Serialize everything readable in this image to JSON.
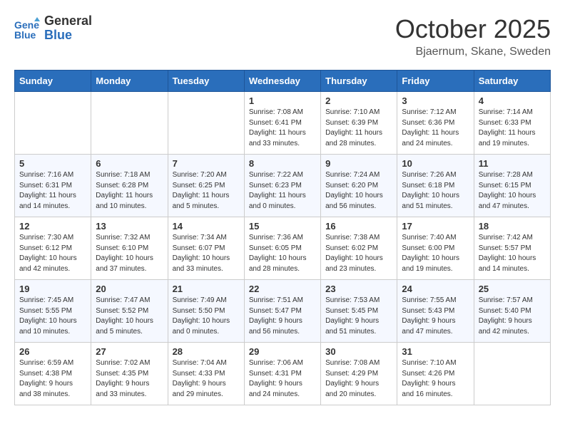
{
  "header": {
    "logo_line1": "General",
    "logo_line2": "Blue",
    "month": "October 2025",
    "location": "Bjaernum, Skane, Sweden"
  },
  "weekdays": [
    "Sunday",
    "Monday",
    "Tuesday",
    "Wednesday",
    "Thursday",
    "Friday",
    "Saturday"
  ],
  "weeks": [
    [
      {
        "day": "",
        "info": ""
      },
      {
        "day": "",
        "info": ""
      },
      {
        "day": "",
        "info": ""
      },
      {
        "day": "1",
        "info": "Sunrise: 7:08 AM\nSunset: 6:41 PM\nDaylight: 11 hours\nand 33 minutes."
      },
      {
        "day": "2",
        "info": "Sunrise: 7:10 AM\nSunset: 6:39 PM\nDaylight: 11 hours\nand 28 minutes."
      },
      {
        "day": "3",
        "info": "Sunrise: 7:12 AM\nSunset: 6:36 PM\nDaylight: 11 hours\nand 24 minutes."
      },
      {
        "day": "4",
        "info": "Sunrise: 7:14 AM\nSunset: 6:33 PM\nDaylight: 11 hours\nand 19 minutes."
      }
    ],
    [
      {
        "day": "5",
        "info": "Sunrise: 7:16 AM\nSunset: 6:31 PM\nDaylight: 11 hours\nand 14 minutes."
      },
      {
        "day": "6",
        "info": "Sunrise: 7:18 AM\nSunset: 6:28 PM\nDaylight: 11 hours\nand 10 minutes."
      },
      {
        "day": "7",
        "info": "Sunrise: 7:20 AM\nSunset: 6:25 PM\nDaylight: 11 hours\nand 5 minutes."
      },
      {
        "day": "8",
        "info": "Sunrise: 7:22 AM\nSunset: 6:23 PM\nDaylight: 11 hours\nand 0 minutes."
      },
      {
        "day": "9",
        "info": "Sunrise: 7:24 AM\nSunset: 6:20 PM\nDaylight: 10 hours\nand 56 minutes."
      },
      {
        "day": "10",
        "info": "Sunrise: 7:26 AM\nSunset: 6:18 PM\nDaylight: 10 hours\nand 51 minutes."
      },
      {
        "day": "11",
        "info": "Sunrise: 7:28 AM\nSunset: 6:15 PM\nDaylight: 10 hours\nand 47 minutes."
      }
    ],
    [
      {
        "day": "12",
        "info": "Sunrise: 7:30 AM\nSunset: 6:12 PM\nDaylight: 10 hours\nand 42 minutes."
      },
      {
        "day": "13",
        "info": "Sunrise: 7:32 AM\nSunset: 6:10 PM\nDaylight: 10 hours\nand 37 minutes."
      },
      {
        "day": "14",
        "info": "Sunrise: 7:34 AM\nSunset: 6:07 PM\nDaylight: 10 hours\nand 33 minutes."
      },
      {
        "day": "15",
        "info": "Sunrise: 7:36 AM\nSunset: 6:05 PM\nDaylight: 10 hours\nand 28 minutes."
      },
      {
        "day": "16",
        "info": "Sunrise: 7:38 AM\nSunset: 6:02 PM\nDaylight: 10 hours\nand 23 minutes."
      },
      {
        "day": "17",
        "info": "Sunrise: 7:40 AM\nSunset: 6:00 PM\nDaylight: 10 hours\nand 19 minutes."
      },
      {
        "day": "18",
        "info": "Sunrise: 7:42 AM\nSunset: 5:57 PM\nDaylight: 10 hours\nand 14 minutes."
      }
    ],
    [
      {
        "day": "19",
        "info": "Sunrise: 7:45 AM\nSunset: 5:55 PM\nDaylight: 10 hours\nand 10 minutes."
      },
      {
        "day": "20",
        "info": "Sunrise: 7:47 AM\nSunset: 5:52 PM\nDaylight: 10 hours\nand 5 minutes."
      },
      {
        "day": "21",
        "info": "Sunrise: 7:49 AM\nSunset: 5:50 PM\nDaylight: 10 hours\nand 0 minutes."
      },
      {
        "day": "22",
        "info": "Sunrise: 7:51 AM\nSunset: 5:47 PM\nDaylight: 9 hours\nand 56 minutes."
      },
      {
        "day": "23",
        "info": "Sunrise: 7:53 AM\nSunset: 5:45 PM\nDaylight: 9 hours\nand 51 minutes."
      },
      {
        "day": "24",
        "info": "Sunrise: 7:55 AM\nSunset: 5:43 PM\nDaylight: 9 hours\nand 47 minutes."
      },
      {
        "day": "25",
        "info": "Sunrise: 7:57 AM\nSunset: 5:40 PM\nDaylight: 9 hours\nand 42 minutes."
      }
    ],
    [
      {
        "day": "26",
        "info": "Sunrise: 6:59 AM\nSunset: 4:38 PM\nDaylight: 9 hours\nand 38 minutes."
      },
      {
        "day": "27",
        "info": "Sunrise: 7:02 AM\nSunset: 4:35 PM\nDaylight: 9 hours\nand 33 minutes."
      },
      {
        "day": "28",
        "info": "Sunrise: 7:04 AM\nSunset: 4:33 PM\nDaylight: 9 hours\nand 29 minutes."
      },
      {
        "day": "29",
        "info": "Sunrise: 7:06 AM\nSunset: 4:31 PM\nDaylight: 9 hours\nand 24 minutes."
      },
      {
        "day": "30",
        "info": "Sunrise: 7:08 AM\nSunset: 4:29 PM\nDaylight: 9 hours\nand 20 minutes."
      },
      {
        "day": "31",
        "info": "Sunrise: 7:10 AM\nSunset: 4:26 PM\nDaylight: 9 hours\nand 16 minutes."
      },
      {
        "day": "",
        "info": ""
      }
    ]
  ]
}
